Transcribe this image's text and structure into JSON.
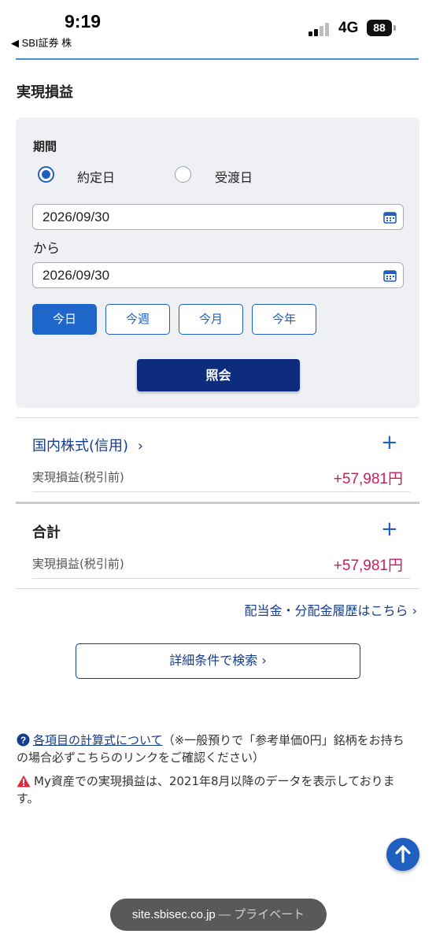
{
  "status_bar": {
    "time": "9:19",
    "back_app": "◀ SBI証券 株",
    "network": "4G",
    "battery": "88"
  },
  "page": {
    "title": "実現損益"
  },
  "search": {
    "period_label": "期間",
    "options": [
      {
        "label": "約定日",
        "selected": true
      },
      {
        "label": "受渡日",
        "selected": false
      }
    ],
    "from_date": "2026/09/30",
    "separator": "から",
    "to_date": "2026/09/30",
    "quick_buttons": [
      {
        "label": "今日",
        "active": true
      },
      {
        "label": "今週",
        "active": false
      },
      {
        "label": "今月",
        "active": false
      },
      {
        "label": "今年",
        "active": false
      }
    ],
    "submit_label": "照会"
  },
  "sections": [
    {
      "title": "国内株式(信用)",
      "chevron": "›",
      "row_label": "実現損益(税引前)",
      "row_value": "+57,981円"
    }
  ],
  "total": {
    "title": "合計",
    "row_label": "実現損益(税引前)",
    "row_value": "+57,981円"
  },
  "links": {
    "dividend": "配当金・分配金履歴はこちら ›",
    "detail_search": "詳細条件で検索 ›"
  },
  "notes": {
    "calc_link": "各項目の計算式について",
    "calc_text": "（※一般預りで「参考単価0円」銘柄をお持ちの場合必ずこちらのリンクをご確認ください）",
    "warning_text": "My資産での実現損益は、2021年8月以降のデータを表示しております。"
  },
  "browser": {
    "domain": "site.sbisec.co.jp",
    "suffix": " — プライベート"
  },
  "colors": {
    "accent_blue": "#1f5fbf",
    "navy": "#0e2c7e",
    "link": "#163c8c",
    "positive": "#d3195a",
    "warning": "#e0293a"
  },
  "icons": {
    "calendar": "calendar-icon",
    "plus": "plus-icon",
    "help": "question-circle-icon",
    "warning": "warning-triangle-icon",
    "scroll_top": "arrow-up-icon"
  }
}
